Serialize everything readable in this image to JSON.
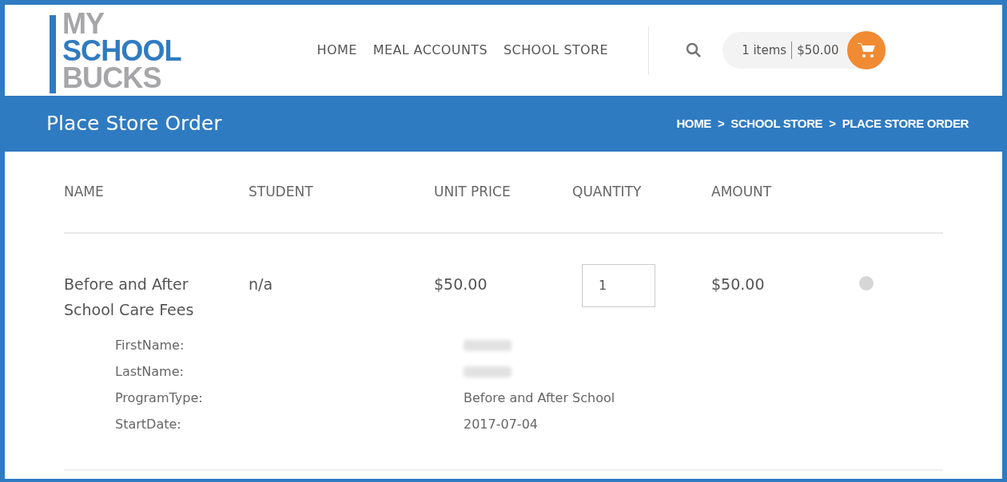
{
  "logo": {
    "lines": [
      "MY",
      "SCHOOL",
      "BUCKS"
    ]
  },
  "nav": [
    "HOME",
    "MEAL ACCOUNTS",
    "SCHOOL STORE"
  ],
  "cart": {
    "items": "1 items",
    "total": "$50.00"
  },
  "page_title": "Place Store Order",
  "breadcrumb": [
    "HOME",
    "SCHOOL STORE",
    "PLACE STORE ORDER"
  ],
  "breadcrumb_separator": ">",
  "table": {
    "columns": [
      "NAME",
      "STUDENT",
      "UNIT PRICE",
      "QUANTITY",
      "AMOUNT"
    ],
    "rows": [
      {
        "name": "Before and After School Care Fees",
        "student": "n/a",
        "unit_price": "$50.00",
        "quantity": "1",
        "amount": "$50.00",
        "details": [
          {
            "label": "FirstName:",
            "kind": "redacted"
          },
          {
            "label": "LastName:",
            "kind": "redacted"
          },
          {
            "label": "ProgramType:",
            "kind": "text",
            "value": "Before and After School"
          },
          {
            "label": "StartDate:",
            "kind": "text",
            "value": "2017-07-04"
          }
        ]
      }
    ]
  }
}
